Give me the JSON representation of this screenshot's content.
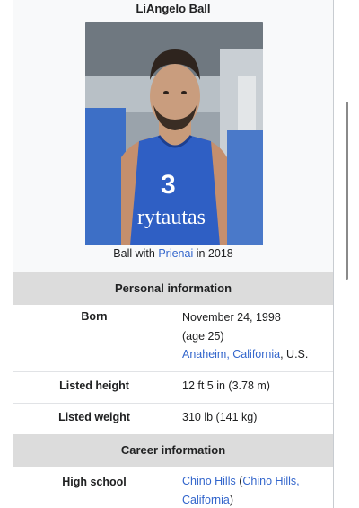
{
  "infobox": {
    "title": "LiAngelo Ball",
    "caption": {
      "prefix": "Ball with ",
      "link": "Prienai",
      "suffix": " in 2018"
    },
    "sections": {
      "personal": "Personal information",
      "career": "Career information"
    },
    "rows": {
      "born": {
        "label": "Born",
        "date": "November 24, 1998",
        "age": "(age 25)",
        "place_link": "Anaheim, California",
        "place_suffix": ", U.S."
      },
      "height": {
        "label": "Listed height",
        "value": "12 ft 5 in (3.78 m)"
      },
      "weight": {
        "label": "Listed weight",
        "value": "310 lb (141 kg)"
      },
      "high_school": {
        "label": "High school",
        "school_link": "Chino Hills",
        "paren_open": " (",
        "location_link": "Chino Hills, California",
        "paren_close": ")"
      }
    },
    "jersey": {
      "number": "3",
      "sponsor": "rytautas"
    }
  },
  "colors": {
    "link": "#3366cc",
    "section_bg": "#dcdcdc",
    "infobox_bg": "#f8f9fa",
    "jersey": "#2f5fc4"
  }
}
